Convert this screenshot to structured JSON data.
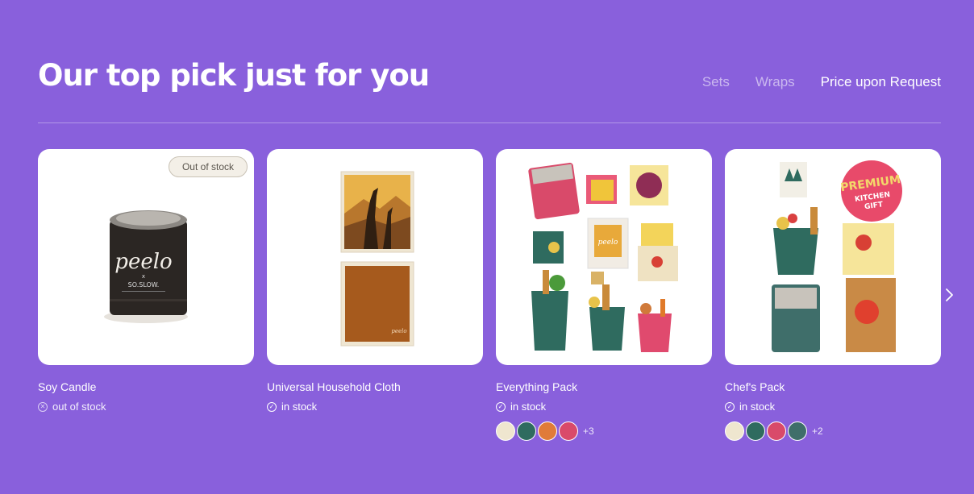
{
  "header": {
    "title": "Our top pick just for you",
    "tabs": [
      {
        "label": "Sets",
        "active": false
      },
      {
        "label": "Wraps",
        "active": false
      },
      {
        "label": "Price upon Request",
        "active": true
      }
    ]
  },
  "products": [
    {
      "name": "Soy Candle",
      "stock_label": "out of stock",
      "in_stock": false,
      "badge": "Out of stock",
      "more": ""
    },
    {
      "name": "Universal Household Cloth",
      "stock_label": "in stock",
      "in_stock": true,
      "badge": "",
      "more": ""
    },
    {
      "name": "Everything Pack",
      "stock_label": "in stock",
      "in_stock": true,
      "badge": "",
      "swatches": [
        "#efe6cf",
        "#2f6b5f",
        "#e07b39",
        "#d94a6a"
      ],
      "more": "+3"
    },
    {
      "name": "Chef's Pack",
      "stock_label": "in stock",
      "in_stock": true,
      "badge": "",
      "swatches": [
        "#efe6cf",
        "#2f6b5f",
        "#d94a6a",
        "#3f6e6a"
      ],
      "more": "+2"
    }
  ],
  "images": {
    "candle_brand": "peelo",
    "candle_x": "x",
    "candle_collab": "SO.SLOW.",
    "cloth_brand": "peelo",
    "pack_brand": "peelo",
    "chef_badge_line1": "PREMIUM",
    "chef_badge_line2": "KITCHEN",
    "chef_badge_line3": "GIFT"
  },
  "colors": {
    "background": "#8960dc",
    "card": "#ffffff"
  },
  "icons": {
    "check": "check-circle-icon",
    "out": "x-circle-icon",
    "next": "chevron-right-icon"
  }
}
